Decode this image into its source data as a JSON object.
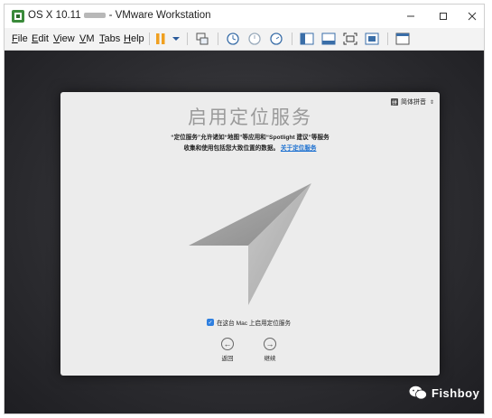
{
  "window": {
    "title_prefix": "OS X 10.11",
    "title_suffix": "- VMware Workstation"
  },
  "menu": {
    "items": [
      "File",
      "Edit",
      "View",
      "VM",
      "Tabs",
      "Help"
    ]
  },
  "toolbar": {
    "icons": [
      "pause-icon",
      "dropdown-icon",
      "send-ctrl-alt-del-icon",
      "snapshot-icon",
      "revert-snapshot-icon",
      "snapshot-manager-icon",
      "sidebar-icon",
      "console-view-icon",
      "full-screen-icon",
      "unity-icon",
      "thumbnail-bar-icon"
    ]
  },
  "setup": {
    "language": "简体拼音",
    "title": "启用定位服务",
    "desc_line1": "“定位服务”允许诸如“地图”等应用和“Spotlight 建议”等服务",
    "desc_line2": "收集和使用包括您大致位置的数据。",
    "desc_link": "关于定位服务",
    "checkbox_label": "在这台 Mac 上启用定位服务",
    "checkbox_checked": true,
    "back_label": "返回",
    "continue_label": "继续"
  },
  "watermark": {
    "text": "Fishboy"
  },
  "colors": {
    "accent": "#2e7fe0",
    "link": "#1a6fd0",
    "pause": "#f0a020",
    "vm_background": "#2c2c30"
  }
}
